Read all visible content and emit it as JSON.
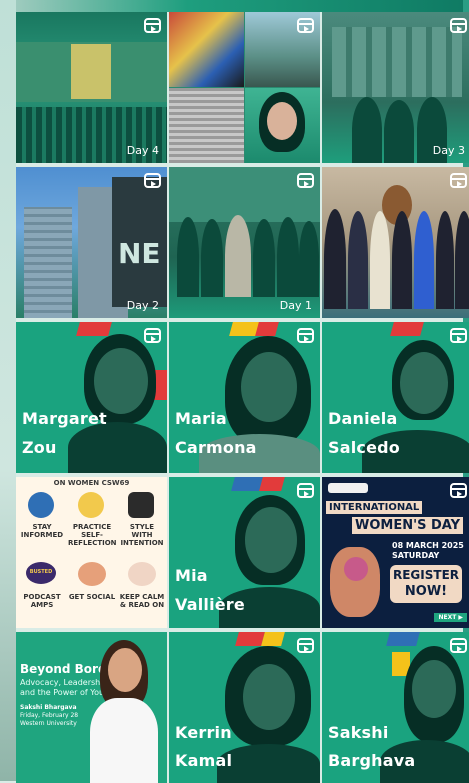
{
  "tiles": [
    {
      "name": "tile-1",
      "kind": "photo",
      "day_label": "Day 4",
      "colors": [
        "#0f5f4b",
        "#2e8a6f",
        "#c9c26a"
      ]
    },
    {
      "name": "tile-2",
      "kind": "collage",
      "colors": [
        "#1a1a1a",
        "#c0c0c0",
        "#3a7f6c"
      ]
    },
    {
      "name": "tile-3",
      "kind": "photo",
      "day_label": "Day 3",
      "colors": [
        "#3d7f6f",
        "#245c4d",
        "#1d9b7a"
      ]
    },
    {
      "name": "tile-4",
      "kind": "photo",
      "day_label": "Day 2",
      "colors": [
        "#4f8fd1",
        "#2a6b5a",
        "#1d9b7a"
      ]
    },
    {
      "name": "tile-5",
      "kind": "photo",
      "day_label": "Day 1",
      "colors": [
        "#2f7a66",
        "#1a4f42",
        "#1d9b7a"
      ]
    },
    {
      "name": "tile-6",
      "kind": "photo",
      "colors": [
        "#3a6f7a",
        "#c8b9a2",
        "#2f3f66"
      ]
    },
    {
      "name": "tile-7",
      "kind": "speaker",
      "name_lines": [
        "Margaret",
        "Zou"
      ],
      "colors": [
        "#1fa57f",
        "#e23b3b",
        "#f4c21a"
      ]
    },
    {
      "name": "tile-8",
      "kind": "speaker",
      "name_lines": [
        "Maria",
        "Carmona"
      ],
      "colors": [
        "#1fa57f",
        "#e23b3b",
        "#f4c21a"
      ]
    },
    {
      "name": "tile-9",
      "kind": "speaker",
      "name_lines": [
        "Daniela",
        "Salcedo"
      ],
      "colors": [
        "#1fa57f",
        "#e23b3b",
        "#f4c21a"
      ]
    },
    {
      "name": "tile-10",
      "kind": "infographic",
      "header": "ON WOMEN CSW69",
      "items": [
        "STAY INFORMED",
        "PRACTICE SELF-REFLECTION",
        "STYLE WITH INTENTION",
        "BUSTED",
        "PODCAST AMPS",
        "GET SOCIAL",
        "KEEP CALM & READ ON"
      ],
      "colors": [
        "#fff6e8",
        "#e6c9a7"
      ]
    },
    {
      "name": "tile-11",
      "kind": "speaker",
      "name_lines": [
        "Mia",
        "Vallière"
      ],
      "colors": [
        "#1fa57f",
        "#e23b3b",
        "#f4c21a"
      ]
    },
    {
      "name": "tile-12",
      "kind": "poster",
      "line1": "INTERNATIONAL",
      "line2": "WOMEN'S DAY",
      "date": "08 MARCH 2025",
      "day": "SATURDAY",
      "cta1": "REGISTER",
      "cta2": "NOW!",
      "next": "NEXT ▶",
      "colors": [
        "#0c1f3f",
        "#f1d9c4",
        "#f29a6e"
      ]
    },
    {
      "name": "tile-13",
      "kind": "event",
      "title": "Beyond Borders:",
      "subtitle1": "Advocacy, Leadership,",
      "subtitle2": "and the Power of Youth",
      "speaker": "Sakshi Bhargava",
      "date": "Friday, February 28",
      "venue": "Western University",
      "colors": [
        "#1fa57f",
        "#ffffff"
      ]
    },
    {
      "name": "tile-14",
      "kind": "speaker",
      "name_lines": [
        "Kerrin",
        "Kamal"
      ],
      "colors": [
        "#1fa57f",
        "#e23b3b",
        "#f4c21a"
      ]
    },
    {
      "name": "tile-15",
      "kind": "speaker",
      "name_lines": [
        "Sakshi",
        "Barghava"
      ],
      "colors": [
        "#1fa57f",
        "#e23b3b",
        "#f4c21a"
      ]
    }
  ]
}
